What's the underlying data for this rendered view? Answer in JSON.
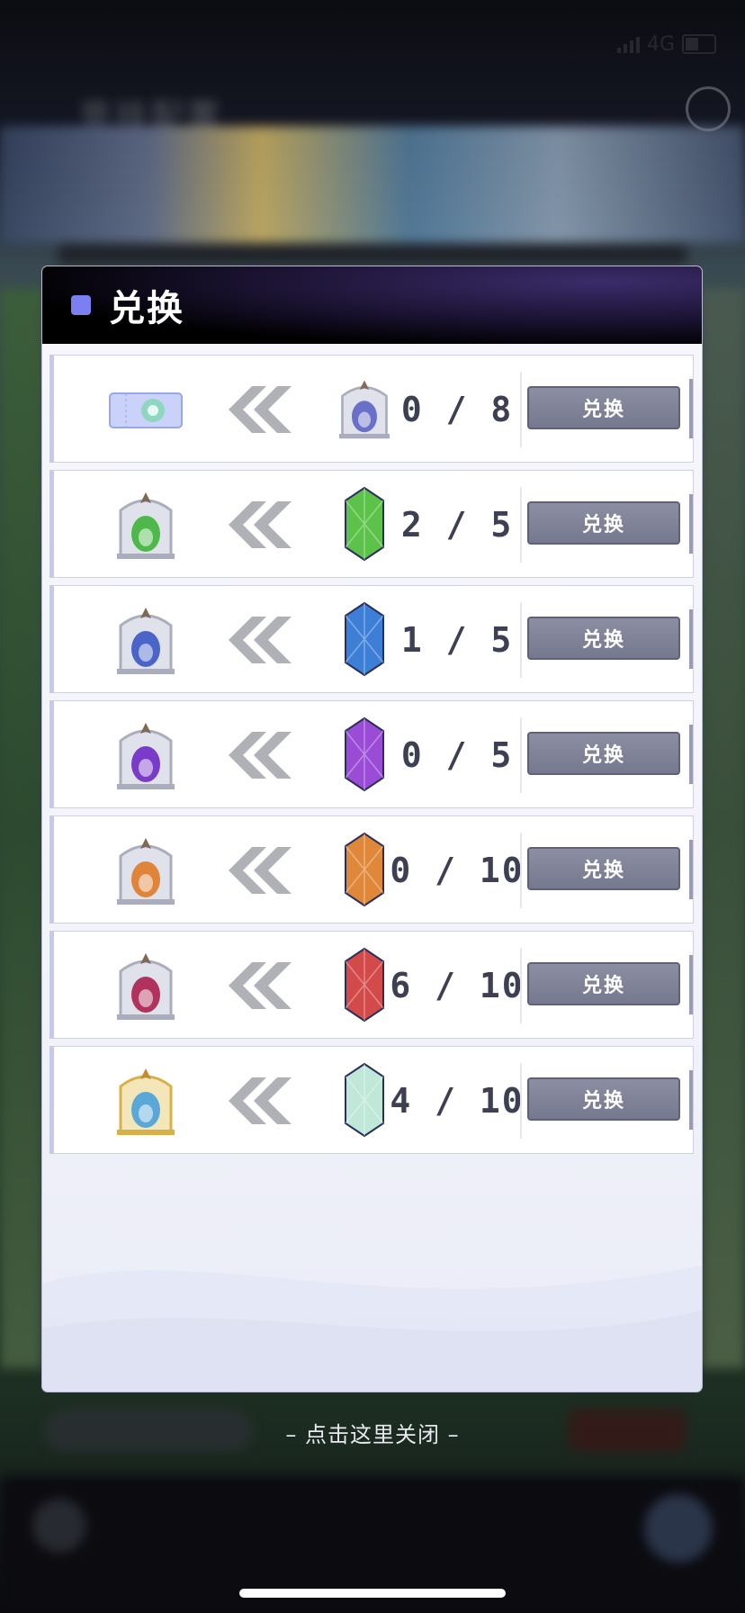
{
  "status_bar": {
    "network": "4G"
  },
  "background": {
    "title": "竞技配置"
  },
  "modal": {
    "title": "兑换",
    "rows": [
      {
        "result_icon": "ticket-icon",
        "gem_icon": "frame-blue-icon",
        "count": "0 / 8",
        "button": "兑换",
        "gem_color": "#6a70c8"
      },
      {
        "result_icon": "frame-green-icon",
        "gem_icon": "gem-green-icon",
        "count": "2 / 5",
        "button": "兑换",
        "gem_color": "#5cc24a"
      },
      {
        "result_icon": "frame-blue-icon",
        "gem_icon": "gem-blue-icon",
        "count": "1 / 5",
        "button": "兑换",
        "gem_color": "#3d7fd6"
      },
      {
        "result_icon": "frame-purple-icon",
        "gem_icon": "gem-purple-icon",
        "count": "0 / 5",
        "button": "兑换",
        "gem_color": "#9a4cd6"
      },
      {
        "result_icon": "frame-orange-icon",
        "gem_icon": "gem-orange-icon",
        "count": "0 / 10",
        "button": "兑换",
        "gem_color": "#e0883a"
      },
      {
        "result_icon": "frame-red-icon",
        "gem_icon": "gem-red-icon",
        "count": "6 / 10",
        "button": "兑换",
        "gem_color": "#d24a4a"
      },
      {
        "result_icon": "frame-gold-icon",
        "gem_icon": "gem-rainbow-icon",
        "count": "4 / 10",
        "button": "兑换",
        "gem_color": "#bfe8d8"
      }
    ]
  },
  "close_hint": "– 点击这里关闭 –"
}
